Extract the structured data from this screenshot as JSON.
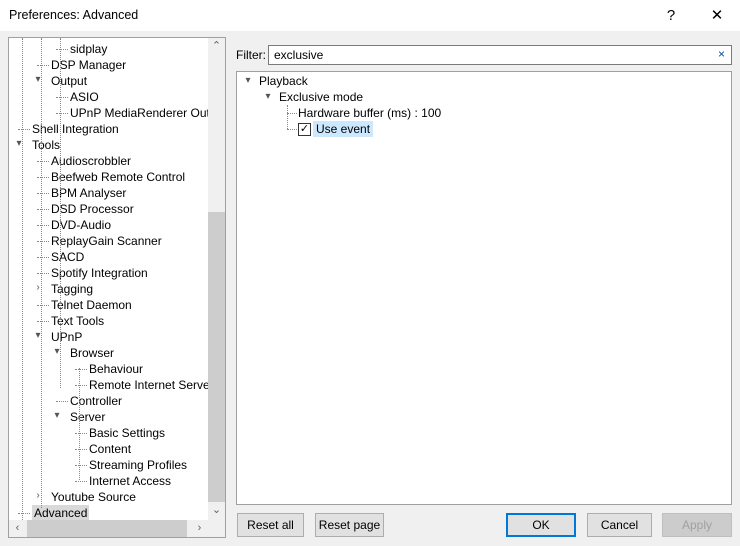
{
  "window": {
    "title": "Preferences: Advanced",
    "help": "?",
    "close": "✕"
  },
  "tree": [
    {
      "label": "sidplay",
      "level": 2,
      "exp": ""
    },
    {
      "label": "DSP Manager",
      "level": 1,
      "exp": ""
    },
    {
      "label": "Output",
      "level": 1,
      "exp": "open"
    },
    {
      "label": "ASIO",
      "level": 2,
      "exp": ""
    },
    {
      "label": "UPnP MediaRenderer Output",
      "level": 2,
      "exp": ""
    },
    {
      "label": "Shell Integration",
      "level": 0,
      "exp": ""
    },
    {
      "label": "Tools",
      "level": 0,
      "exp": "open"
    },
    {
      "label": "Audioscrobbler",
      "level": 1,
      "exp": ""
    },
    {
      "label": "Beefweb Remote Control",
      "level": 1,
      "exp": ""
    },
    {
      "label": "BPM Analyser",
      "level": 1,
      "exp": ""
    },
    {
      "label": "DSD Processor",
      "level": 1,
      "exp": ""
    },
    {
      "label": "DVD-Audio",
      "level": 1,
      "exp": ""
    },
    {
      "label": "ReplayGain Scanner",
      "level": 1,
      "exp": ""
    },
    {
      "label": "SACD",
      "level": 1,
      "exp": ""
    },
    {
      "label": "Spotify Integration",
      "level": 1,
      "exp": ""
    },
    {
      "label": "Tagging",
      "level": 1,
      "exp": "closed"
    },
    {
      "label": "Telnet Daemon",
      "level": 1,
      "exp": ""
    },
    {
      "label": "Text Tools",
      "level": 1,
      "exp": ""
    },
    {
      "label": "UPnP",
      "level": 1,
      "exp": "open"
    },
    {
      "label": "Browser",
      "level": 2,
      "exp": "open"
    },
    {
      "label": "Behaviour",
      "level": 3,
      "exp": ""
    },
    {
      "label": "Remote Internet Servers",
      "level": 3,
      "exp": ""
    },
    {
      "label": "Controller",
      "level": 2,
      "exp": ""
    },
    {
      "label": "Server",
      "level": 2,
      "exp": "open"
    },
    {
      "label": "Basic Settings",
      "level": 3,
      "exp": ""
    },
    {
      "label": "Content",
      "level": 3,
      "exp": ""
    },
    {
      "label": "Streaming Profiles",
      "level": 3,
      "exp": ""
    },
    {
      "label": "Internet Access",
      "level": 3,
      "exp": ""
    },
    {
      "label": "Youtube Source",
      "level": 1,
      "exp": "closed"
    },
    {
      "label": "Advanced",
      "level": 0,
      "exp": "",
      "selected": true
    }
  ],
  "filter": {
    "label": "Filter:",
    "value": "exclusive",
    "clear": "×"
  },
  "settings": {
    "playback": "Playback",
    "exclusive_mode": "Exclusive mode",
    "hardware_buffer": "Hardware buffer (ms) : 100",
    "use_event": "Use event",
    "use_event_checked": true
  },
  "buttons": {
    "reset_all": "Reset all",
    "reset_page": "Reset page",
    "ok": "OK",
    "cancel": "Cancel",
    "apply": "Apply"
  }
}
